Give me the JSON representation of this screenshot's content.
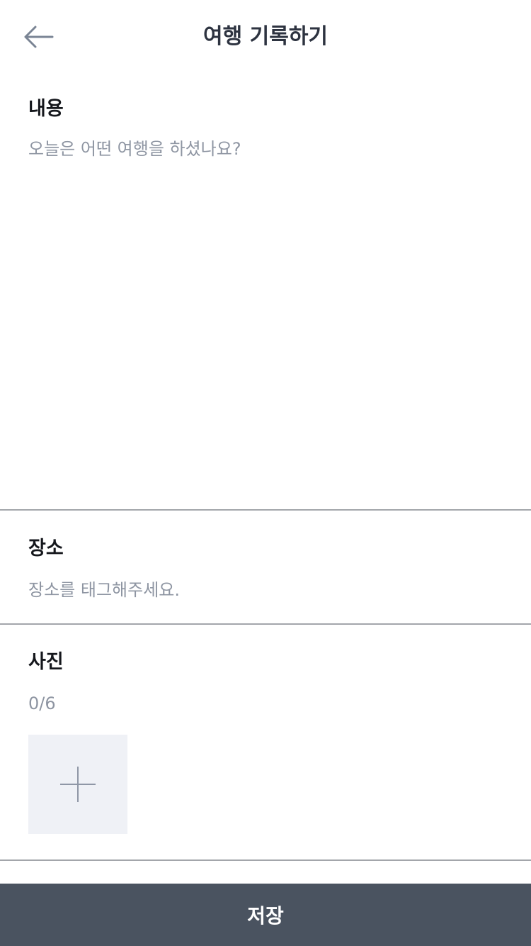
{
  "header": {
    "back_icon": "arrow-left-icon",
    "title": "여행 기록하기"
  },
  "content": {
    "label": "내용",
    "placeholder": "오늘은 어떤 여행을 하셨나요?",
    "value": ""
  },
  "location": {
    "label": "장소",
    "placeholder": "장소를 태그해주세요."
  },
  "photos": {
    "label": "사진",
    "count": "0/6",
    "add_icon": "plus-icon"
  },
  "footer": {
    "save_label": "저장"
  },
  "colors": {
    "header_title": "#2d3340",
    "placeholder": "#8e95a2",
    "divider": "#a3a6ab",
    "photo_tile": "#eff1f6",
    "save_button": "#4a5360"
  }
}
